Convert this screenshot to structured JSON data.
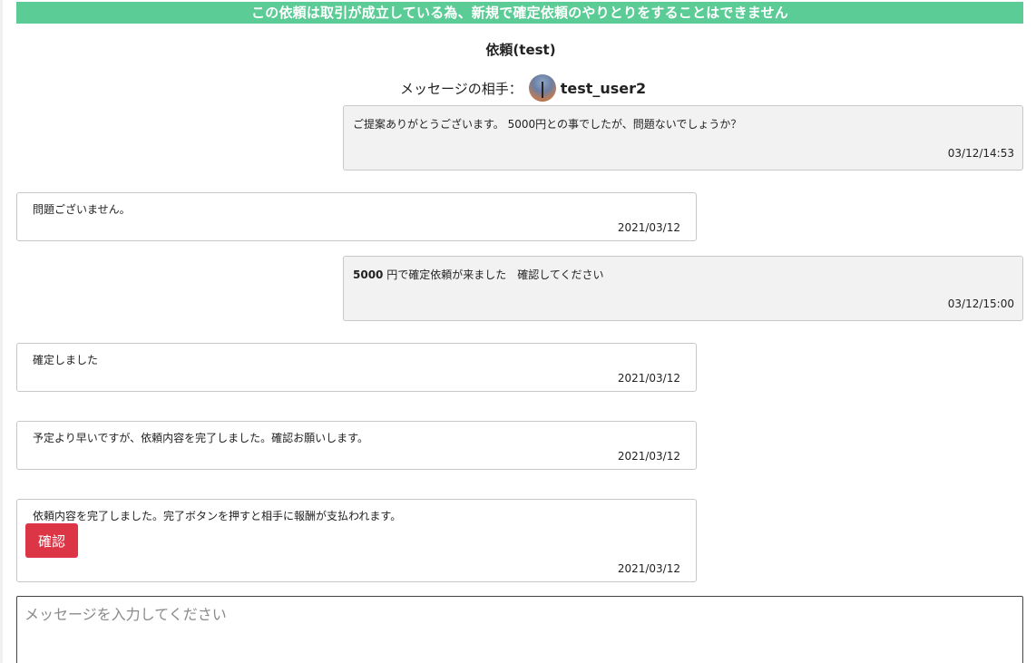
{
  "banner": {
    "text": "この依頼は取引が成立している為、新規で確定依頼のやりとりをすることはできません",
    "color": "#5ccc96"
  },
  "page_title": "依頼(test)",
  "partner": {
    "label": "メッセージの相手：",
    "name": "test_user2",
    "avatar_icon": "avatar-photo"
  },
  "messages": [
    {
      "side": "mine",
      "text": "ご提案ありがとうございます。 5000円との事でしたが、問題ないでしょうか？",
      "time": "03/12/14:53"
    },
    {
      "side": "theirs",
      "text": "問題ございません。",
      "time": "2021/03/12"
    },
    {
      "side": "mine",
      "amount": "5000",
      "text": " 円で確定依頼が来ました　確認してください",
      "time": "03/12/15:00"
    },
    {
      "side": "theirs",
      "text": "確定しました",
      "time": "2021/03/12"
    },
    {
      "side": "theirs",
      "text": "予定より早いですが、依頼内容を完了しました。確認お願いします。",
      "time": "2021/03/12"
    },
    {
      "side": "theirs",
      "text": "依頼内容を完了しました。完了ボタンを押すと相手に報酬が支払われます。",
      "button_label": "確認",
      "time": "2021/03/12"
    }
  ],
  "composer": {
    "placeholder": "メッセージを入力してください",
    "value": ""
  },
  "colors": {
    "confirm_button": "#dc3545",
    "my_message_bg": "#f2f2f2"
  }
}
